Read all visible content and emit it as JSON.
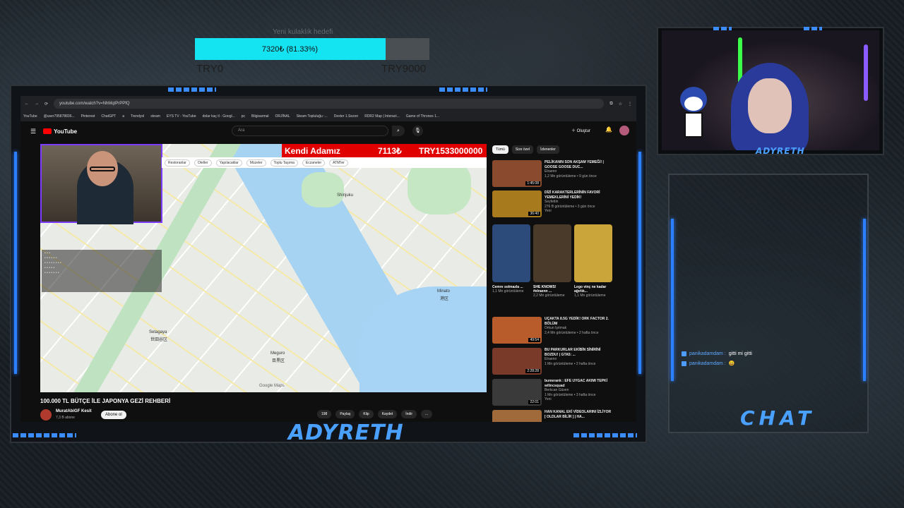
{
  "goal": {
    "title": "Yeni kulaklık hedefi",
    "amount_label": "7320₺ (81.33%)",
    "progress_percent": 81.33,
    "min_label": "TRY0",
    "max_label": "TRY9000"
  },
  "browser": {
    "url": "youtube.com/watch?v=NhMqtPrPPfQ",
    "bookmarks": [
      "YouTube",
      "@user795878836...",
      "Pinterest",
      "ChatGPT",
      "a",
      "Trendyol",
      "steam",
      "EYS TV - YouTube",
      "dolar kaç tl - Googl...",
      "pc",
      "Bilgisarmal",
      "ORJİNAL",
      "Steam Topluluğu :...",
      "Dexter 1.Sezon",
      "RDR2 Map | Interact...",
      "Game of Thrones 1..."
    ]
  },
  "youtube": {
    "logo_text": "YouTube",
    "search_placeholder": "Ara",
    "create_label": "Oluştur",
    "bell_badge": "9+",
    "video_title": "100.000 TL BÜTÇE İLE JAPONYA GEZİ REHBERİ",
    "channel_name": "MuratAbiGF Kesit",
    "channel_subs": "7,3 B abone",
    "subscribe_label": "Abone ol",
    "actions": [
      "198",
      "Paylaş",
      "Klip",
      "Kaydet",
      "İndir",
      "..."
    ],
    "chips": [
      "Tümü",
      "Size özel",
      "İzlenenler"
    ],
    "recommendations": [
      {
        "title": "PELİKANIN SON AKŞAM YEMEĞİ! | GOOSE GOOSE DUC...",
        "channel": "Elraenn",
        "meta": "1,2 Mn görüntüleme • 9 gün önce",
        "duration": "1:45:08",
        "color": "#8a4a2e"
      },
      {
        "title": "DİZİ KARAKTERLERİNİN FAVORİ YEMEKLERİNİ YEDİK!",
        "channel": "Seyfettin",
        "meta": "276 B görüntüleme • 3 gün önce",
        "badge": "Yeni",
        "duration": "36:40",
        "color": "#a87a1e"
      }
    ],
    "shorts": [
      {
        "title": "Cemre solmazla ...",
        "meta": "1,1 Mn görüntüleme",
        "color": "#2c4a7a"
      },
      {
        "title": "SHE KNOWS! #elraenn ...",
        "meta": "2,2 Mn görüntüleme",
        "color": "#4a3a2a"
      },
      {
        "title": "Lego vinç ne kadar ağırlık...",
        "meta": "1,1 Mn görüntüleme",
        "color": "#c9a53a"
      }
    ],
    "recommendations2": [
      {
        "title": "UÇAKTA 8.5G YEDİK! ORK FACTOR 2. BÖLÜM",
        "channel": "Orkun Işıtmak",
        "meta": "2,4 Mn görüntüleme • 2 hafta önce",
        "duration": "49:54",
        "color": "#b95c2c"
      },
      {
        "title": "BU PARKURLAR EKİBİN SİNİRİNİ BOZDU! | GTA5: ...",
        "channel": "Elraenn",
        "meta": "1 Mn görüntüleme • 2 hafta önce",
        "duration": "2:28:28",
        "color": "#7a3a2a"
      },
      {
        "title": "bumerank : EFE UYGAC AKIMI TEPKİ w/lincsquad",
        "channel": "Berkcan Güven",
        "meta": "1 Mn görüntüleme • 3 hafta önce",
        "badge": "Yeni",
        "duration": "22:01",
        "color": "#3a3a3a"
      },
      {
        "title": "HAN KANAL EKİ VİDEOLARINI İZLİYOR [ OLDLAR BİLİR ] | HA...",
        "channel": "",
        "meta": "",
        "duration": "",
        "color": "#a06a3a"
      }
    ]
  },
  "video_overlay": {
    "red_bar_left": "Kendi Adamız",
    "red_bar_mid": "7113₺",
    "red_bar_right": "TRY1533000000",
    "map_chips": [
      "Restoranlar",
      "Oteller",
      "Yapılacaklar",
      "Müzeler",
      "Toplu Taşıma",
      "Eczaneler",
      "ATM'ler"
    ],
    "map_labels": [
      "Setagaya",
      "世田谷区",
      "Meguro",
      "目黒区",
      "Minato",
      "港区",
      "Shinjuku"
    ],
    "google_maps": "Google Maps"
  },
  "streamer": {
    "name_top": "ADYRETH",
    "name_bottom": "ADYRETH",
    "chat_title": "CHAT",
    "chat_messages": [
      {
        "user": "panikadamdam",
        "text": "gitti mi gitti"
      },
      {
        "user": "panikadamdam",
        "text": "😄"
      }
    ]
  }
}
